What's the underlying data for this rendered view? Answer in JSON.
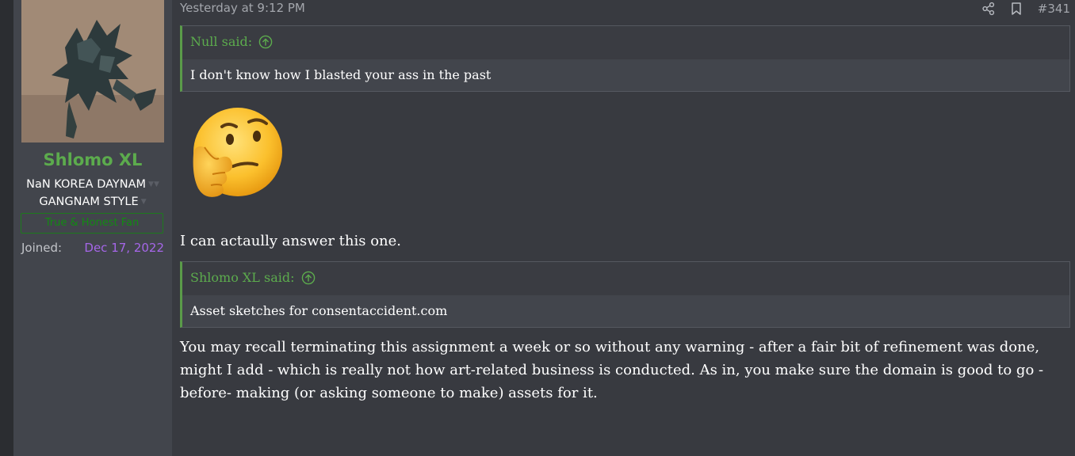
{
  "user": {
    "name": "Shlomo XL",
    "title_line1": "NaN KOREA DAYNAM",
    "title_line2": "GANGNAM STYLE",
    "banner": "True & Honest Fan",
    "joined_label": "Joined:",
    "joined_value": "Dec 17, 2022"
  },
  "post": {
    "timestamp": "Yesterday at 9:12 PM",
    "number": "#341",
    "quote1": {
      "author": "Null said:",
      "text": "I don't know how I blasted your ass in the past"
    },
    "paragraph1": "I can actaully answer this one.",
    "quote2": {
      "author": "Shlomo XL said:",
      "text": "Asset sketches for consentaccident.com"
    },
    "paragraph2": "You may recall terminating this assignment a week or so without any warning - after a fair bit of refinement was done, might I add - which is really not how art-related business is conducted. As in, you make sure the domain is good to go -before- making (or asking someone to make) assets for it."
  },
  "icons": {
    "share": "share-icon",
    "bookmark": "bookmark-icon",
    "quote_up": "arrow-up-circle-icon",
    "emoji": "thinking-face-emoji"
  },
  "colors": {
    "username": "#5cab4d",
    "joined_date": "#a566e8",
    "banner": "#138a13",
    "quote_accent": "#5a9b49"
  }
}
